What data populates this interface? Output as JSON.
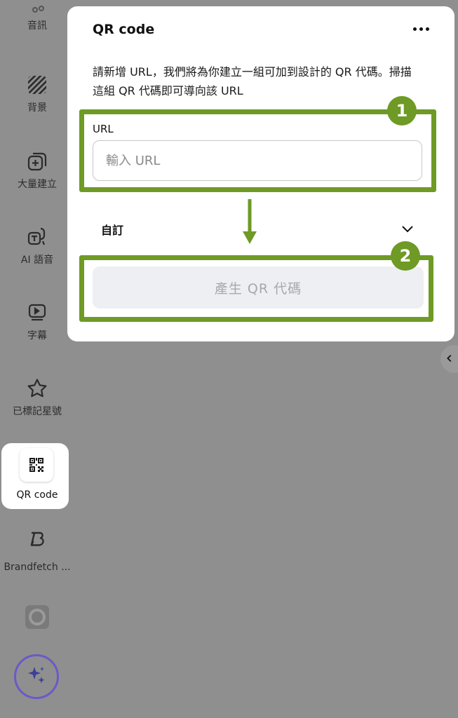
{
  "sidebar": {
    "items": [
      {
        "label": "音訊",
        "icon": "audio-icon"
      },
      {
        "label": "背景",
        "icon": "background-stripes-icon"
      },
      {
        "label": "大量建立",
        "icon": "bulk-create-icon"
      },
      {
        "label": "AI 語音",
        "icon": "ai-voice-icon"
      },
      {
        "label": "字幕",
        "icon": "captions-icon"
      },
      {
        "label": "已標記星號",
        "icon": "star-icon"
      },
      {
        "label": "QR code",
        "icon": "qr-code-icon",
        "active": true
      },
      {
        "label": "Brandfetch ...",
        "icon": "brandfetch-logo-icon"
      },
      {
        "label": "",
        "icon": "app-thumbnail-icon"
      }
    ]
  },
  "panel": {
    "title": "QR code",
    "description": "請新增 URL，我們將為你建立一組可加到設計的 QR 代碼。掃描這組 QR 代碼即可導向該 URL",
    "url_label": "URL",
    "url_value": "",
    "url_placeholder": "輸入 URL",
    "custom_label": "自訂",
    "generate_label": "產生 QR 代碼"
  },
  "annotations": {
    "step1": "1",
    "step2": "2",
    "color": "#6e9a25"
  },
  "colors": {
    "overlay": "#8f8f8f",
    "button_disabled_bg": "#eeeff2",
    "button_disabled_text": "#a5a8ad",
    "magic_ring": "#6a5ac8"
  }
}
